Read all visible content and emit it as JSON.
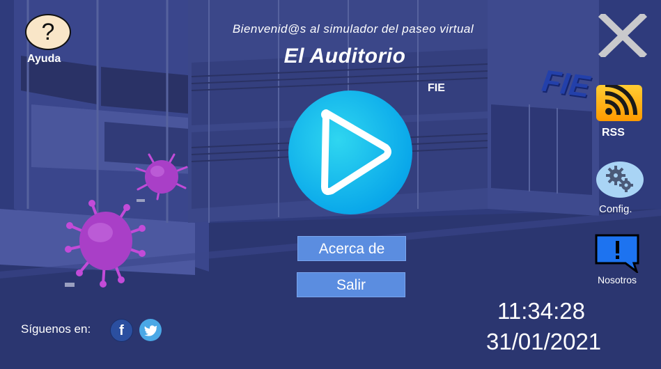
{
  "header": {
    "welcome": "Bienvenid@s al simulador del paseo virtual",
    "title": "El Auditorio",
    "fie_label": "FIE",
    "fie_logo": "FIE"
  },
  "help": {
    "icon_glyph": "?",
    "label": "Ayuda"
  },
  "right_menu": {
    "rss_label": "RSS",
    "config_label": "Config.",
    "us_label": "Nosotros"
  },
  "main": {
    "about_label": "Acerca de",
    "exit_label": "Salir"
  },
  "social": {
    "follow_label": "Síguenos en:",
    "facebook_glyph": "f"
  },
  "clock": {
    "time": "11:34:28",
    "date": "31/01/2021"
  },
  "colors": {
    "background": "#2f3a7a",
    "play_button": "#0aa8ea",
    "menu_button": "#5b8de0",
    "rss": "#ff9a00"
  }
}
